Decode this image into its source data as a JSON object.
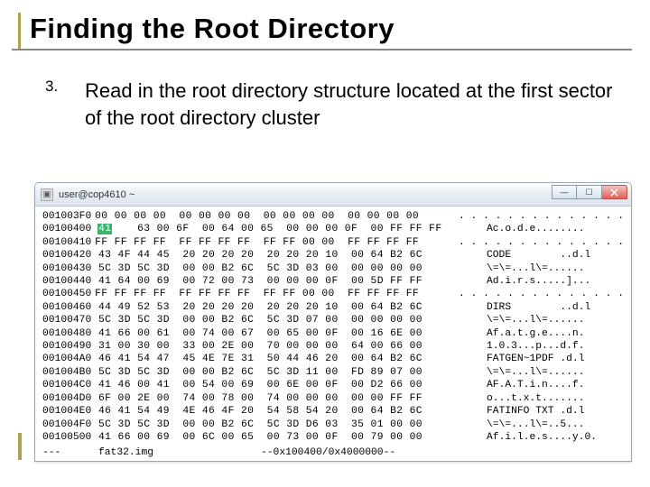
{
  "title": "Finding the Root Directory",
  "list_number": "3.",
  "body_text": "Read in the root directory structure located at the first sector of the root directory cluster",
  "terminal": {
    "title": "user@cop4610 ~",
    "highlight": "41",
    "rows": [
      {
        "addr": "001003F0",
        "bytes": "00 00 00 00  00 00 00 00  00 00 00 00  00 00 00 00",
        "ascii": ". . . . . . . . . . . . . ."
      },
      {
        "addr": "00100400",
        "bytes": "   63 00 6F  00 64 00 65  00 00 00 0F  00 FF FF FF",
        "ascii": "Ac.o.d.e........"
      },
      {
        "addr": "00100410",
        "bytes": "FF FF FF FF  FF FF FF FF  FF FF 00 00  FF FF FF FF",
        "ascii": ". . . . . . . . . . . . . ."
      },
      {
        "addr": "00100420",
        "bytes": "43 4F 44 45  20 20 20 20  20 20 20 10  00 64 B2 6C",
        "ascii": "CODE        ..d.l"
      },
      {
        "addr": "00100430",
        "bytes": "5C 3D 5C 3D  00 00 B2 6C  5C 3D 03 00  00 00 00 00",
        "ascii": "\\=\\=...l\\=......"
      },
      {
        "addr": "00100440",
        "bytes": "41 64 00 69  00 72 00 73  00 00 00 0F  00 5D FF FF",
        "ascii": "Ad.i.r.s.....]..."
      },
      {
        "addr": "00100450",
        "bytes": "FF FF FF FF  FF FF FF FF  FF FF 00 00  FF FF FF FF",
        "ascii": ". . . . . . . . . . . . . ."
      },
      {
        "addr": "00100460",
        "bytes": "44 49 52 53  20 20 20 20  20 20 20 10  00 64 B2 6C",
        "ascii": "DIRS        ..d.l"
      },
      {
        "addr": "00100470",
        "bytes": "5C 3D 5C 3D  00 00 B2 6C  5C 3D 07 00  00 00 00 00",
        "ascii": "\\=\\=...l\\=......"
      },
      {
        "addr": "00100480",
        "bytes": "41 66 00 61  00 74 00 67  00 65 00 0F  00 16 6E 00",
        "ascii": "Af.a.t.g.e....n."
      },
      {
        "addr": "00100490",
        "bytes": "31 00 30 00  33 00 2E 00  70 00 00 00  64 00 66 00",
        "ascii": "1.0.3...p...d.f."
      },
      {
        "addr": "001004A0",
        "bytes": "46 41 54 47  45 4E 7E 31  50 44 46 20  00 64 B2 6C",
        "ascii": "FATGEN~1PDF .d.l"
      },
      {
        "addr": "001004B0",
        "bytes": "5C 3D 5C 3D  00 00 B2 6C  5C 3D 11 00  FD 89 07 00",
        "ascii": "\\=\\=...l\\=......"
      },
      {
        "addr": "001004C0",
        "bytes": "41 46 00 41  00 54 00 69  00 6E 00 0F  00 D2 66 00",
        "ascii": "AF.A.T.i.n....f."
      },
      {
        "addr": "001004D0",
        "bytes": "6F 00 2E 00  74 00 78 00  74 00 00 00  00 00 FF FF",
        "ascii": "o...t.x.t......."
      },
      {
        "addr": "001004E0",
        "bytes": "46 41 54 49  4E 46 4F 20  54 58 54 20  00 64 B2 6C",
        "ascii": "FATINFO TXT .d.l"
      },
      {
        "addr": "001004F0",
        "bytes": "5C 3D 5C 3D  00 00 B2 6C  5C 3D D6 03  35 01 00 00",
        "ascii": "\\=\\=...l\\=..5..."
      },
      {
        "addr": "00100500",
        "bytes": "41 66 00 69  00 6C 00 65  00 73 00 0F  00 79 00 00",
        "ascii": "Af.i.l.e.s....y.0."
      }
    ],
    "status": {
      "file": "fat32.img",
      "pos": "--0x100400/0x4000000--"
    }
  }
}
